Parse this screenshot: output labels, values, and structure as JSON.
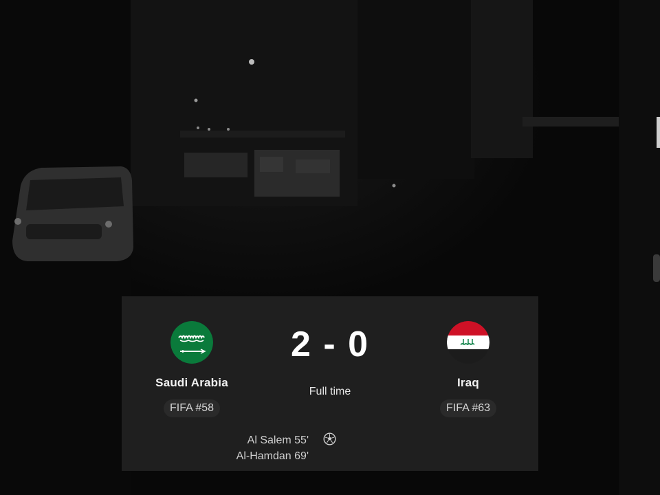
{
  "match": {
    "home": {
      "name": "Saudi Arabia",
      "rank": "FIFA #58",
      "flag_icon": "saudi-arabia-flag-icon",
      "flag_color": "#0a7a3b"
    },
    "away": {
      "name": "Iraq",
      "rank": "FIFA #63",
      "flag_icon": "iraq-flag-icon",
      "flag_colors": [
        "#ce1126",
        "#ffffff",
        "#000000",
        "#007a3d"
      ]
    },
    "score": {
      "home": "2",
      "separator": "-",
      "away": "0"
    },
    "status": "Full time",
    "scorers": {
      "home": [
        "Al Salem 55'",
        "Al-Hamdan 69'"
      ],
      "icon": "soccer-ball-icon"
    }
  },
  "theme": {
    "card_bg": "#1f1f1f",
    "pill_bg": "#2a2a2a",
    "text": "#ffffff"
  }
}
